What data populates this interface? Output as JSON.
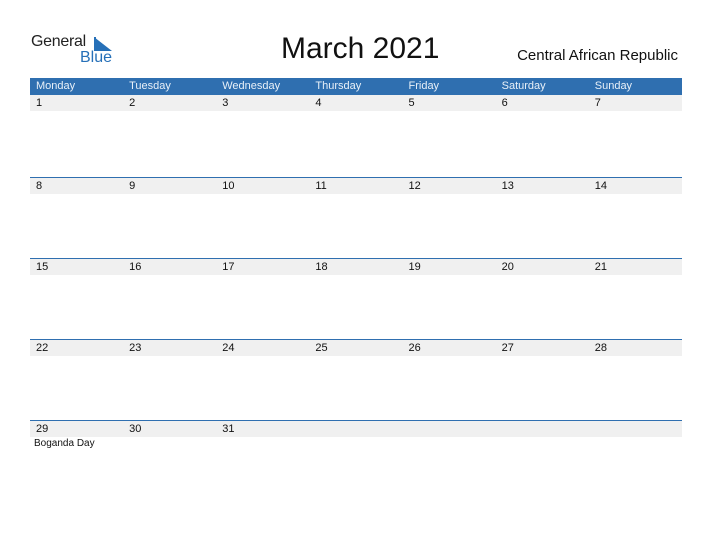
{
  "logo": {
    "text1": "General",
    "text2": "Blue",
    "icon": "triangle-flag-icon"
  },
  "title": "March 2021",
  "country": "Central African Republic",
  "colors": {
    "accent": "#2f6fb0",
    "date_bar": "#f0f0f0",
    "logo_blue": "#2670b8"
  },
  "weekdays": [
    "Monday",
    "Tuesday",
    "Wednesday",
    "Thursday",
    "Friday",
    "Saturday",
    "Sunday"
  ],
  "weeks": [
    {
      "days": [
        "1",
        "2",
        "3",
        "4",
        "5",
        "6",
        "7"
      ],
      "events": [
        "",
        "",
        "",
        "",
        "",
        "",
        ""
      ]
    },
    {
      "days": [
        "8",
        "9",
        "10",
        "11",
        "12",
        "13",
        "14"
      ],
      "events": [
        "",
        "",
        "",
        "",
        "",
        "",
        ""
      ]
    },
    {
      "days": [
        "15",
        "16",
        "17",
        "18",
        "19",
        "20",
        "21"
      ],
      "events": [
        "",
        "",
        "",
        "",
        "",
        "",
        ""
      ]
    },
    {
      "days": [
        "22",
        "23",
        "24",
        "25",
        "26",
        "27",
        "28"
      ],
      "events": [
        "",
        "",
        "",
        "",
        "",
        "",
        ""
      ]
    },
    {
      "days": [
        "29",
        "30",
        "31",
        "",
        "",
        "",
        ""
      ],
      "events": [
        "Boganda Day",
        "",
        "",
        "",
        "",
        "",
        ""
      ]
    }
  ]
}
